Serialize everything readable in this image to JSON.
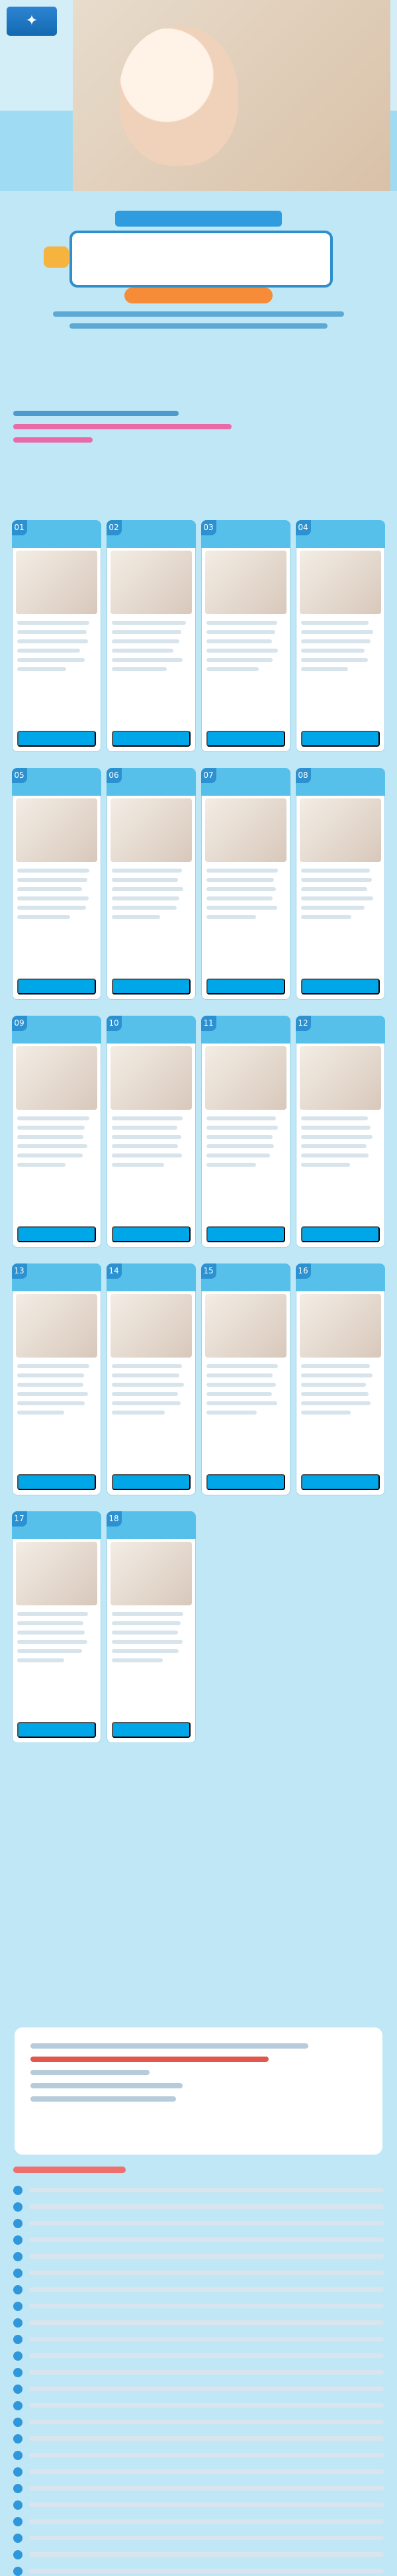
{
  "brand": {
    "logo_name": "pampers-logo",
    "colors": {
      "sky": "#bfe7f5",
      "blue": "#2b91d1",
      "orange": "#f68c37",
      "pink": "#ea6aa8",
      "red": "#e2564c",
      "white": "#ffffff"
    }
  },
  "hero": {
    "title": "",
    "subtitle": ""
  },
  "header": {
    "main_title": "",
    "tagline": "",
    "intro": ""
  },
  "promo": {
    "line_1": "",
    "line_2": ""
  },
  "cards": [
    {
      "num": "01",
      "name1": "",
      "name2": "",
      "vote": ""
    },
    {
      "num": "02",
      "name1": "",
      "name2": "",
      "vote": ""
    },
    {
      "num": "03",
      "name1": "",
      "name2": "",
      "vote": ""
    },
    {
      "num": "04",
      "name1": "",
      "name2": "",
      "vote": ""
    },
    {
      "num": "05",
      "name1": "",
      "name2": "",
      "vote": ""
    },
    {
      "num": "06",
      "name1": "",
      "name2": "",
      "vote": ""
    },
    {
      "num": "07",
      "name1": "",
      "name2": "",
      "vote": ""
    },
    {
      "num": "08",
      "name1": "",
      "name2": "",
      "vote": ""
    },
    {
      "num": "09",
      "name1": "",
      "name2": "",
      "vote": ""
    },
    {
      "num": "10",
      "name1": "",
      "name2": "",
      "vote": ""
    },
    {
      "num": "11",
      "name1": "",
      "name2": "",
      "vote": ""
    },
    {
      "num": "12",
      "name1": "",
      "name2": "",
      "vote": ""
    },
    {
      "num": "13",
      "name1": "",
      "name2": "",
      "vote": ""
    },
    {
      "num": "14",
      "name1": "",
      "name2": "",
      "vote": ""
    },
    {
      "num": "15",
      "name1": "",
      "name2": "",
      "vote": ""
    },
    {
      "num": "16",
      "name1": "",
      "name2": "",
      "vote": ""
    },
    {
      "num": "17",
      "name1": "",
      "name2": "",
      "vote": ""
    },
    {
      "num": "18",
      "name1": "",
      "name2": "",
      "vote": ""
    }
  ],
  "info": {
    "headline": "",
    "line_1": "",
    "line_2": "",
    "line_3": "",
    "line_4": ""
  },
  "notes": {
    "title": "",
    "items": [
      "",
      "",
      "",
      "",
      "",
      "",
      "",
      "",
      "",
      "",
      "",
      "",
      "",
      "",
      "",
      "",
      "",
      "",
      "",
      "",
      "",
      "",
      "",
      ""
    ]
  }
}
